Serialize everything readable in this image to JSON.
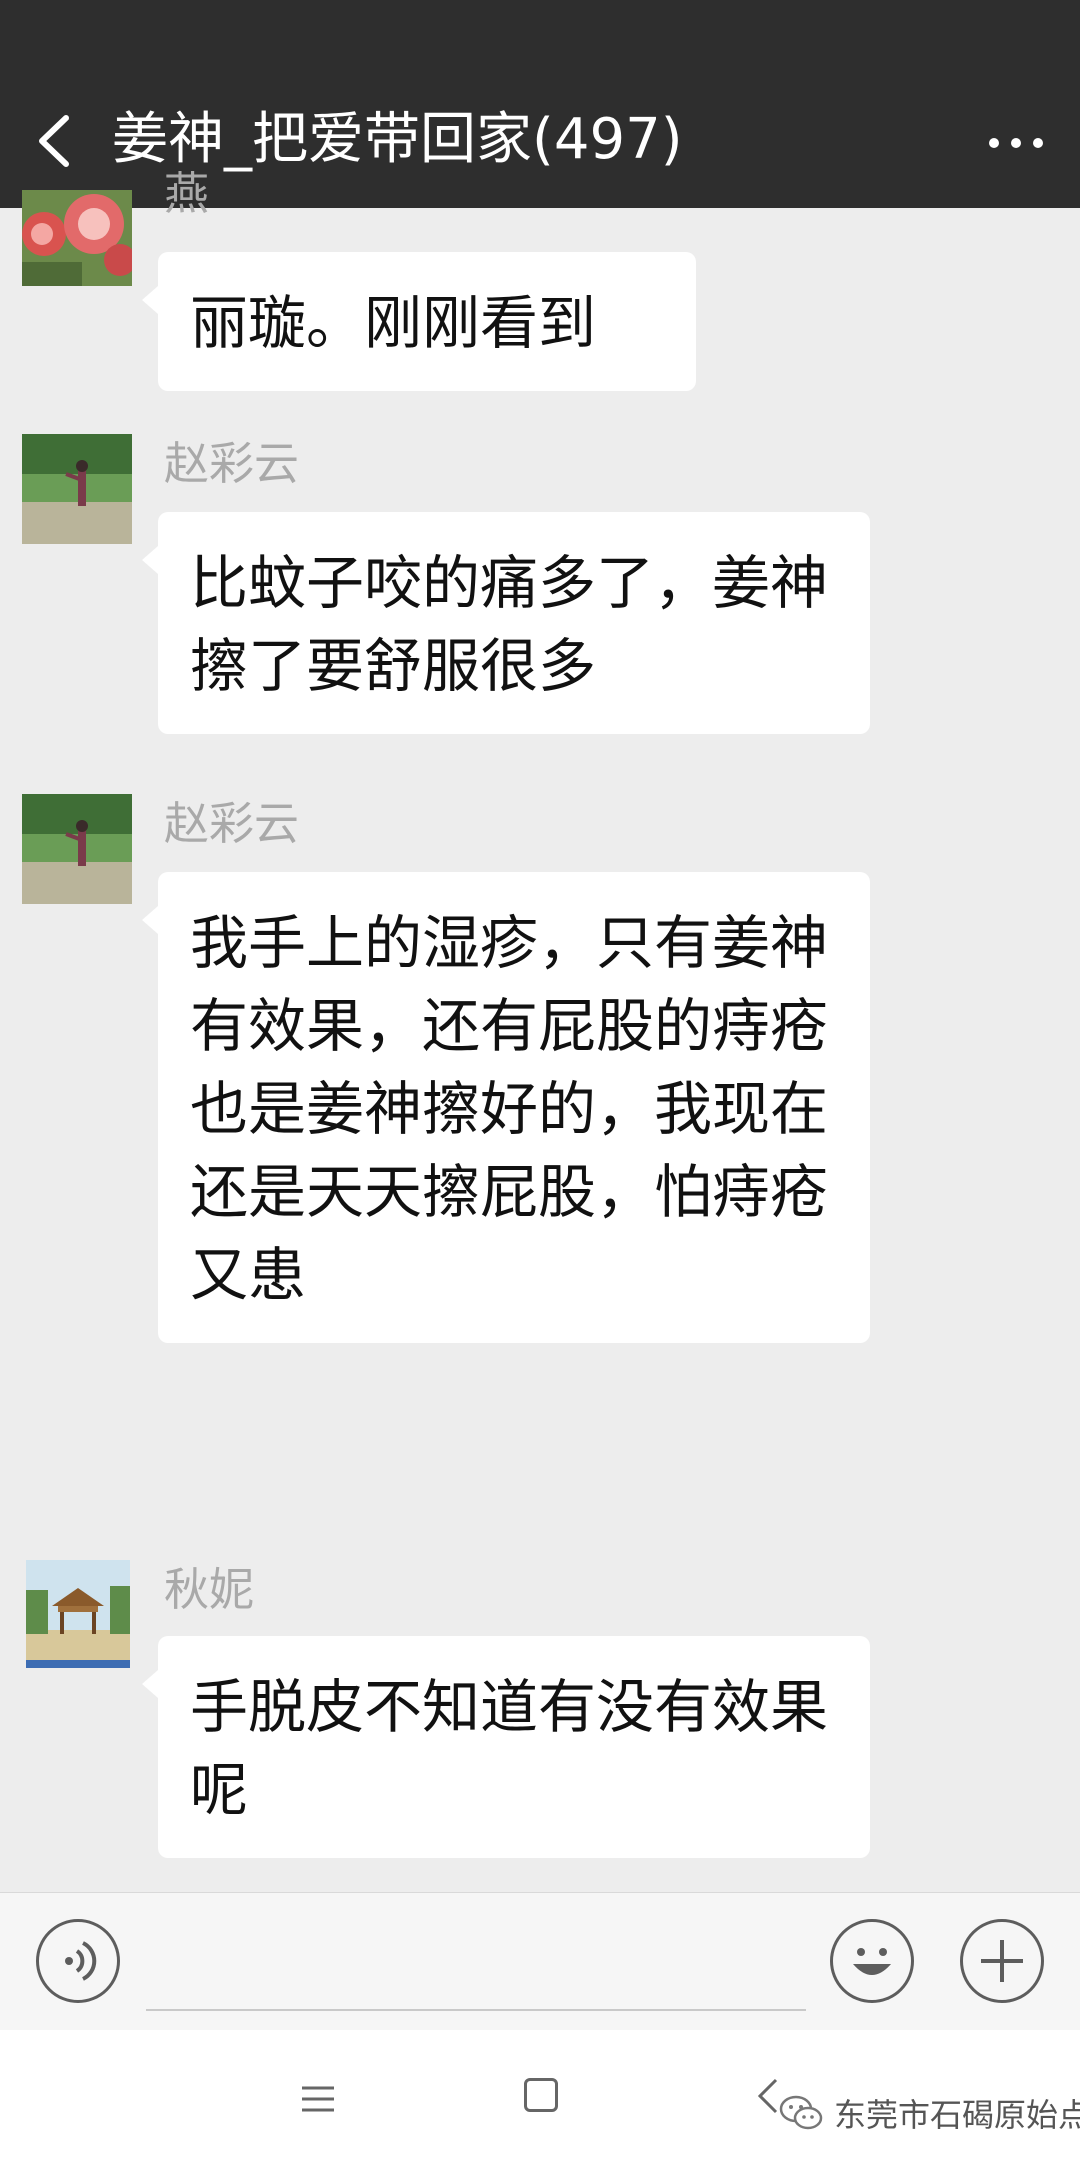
{
  "header": {
    "title": "姜神_把爱带回家(497)",
    "back_icon": "chevron-left-icon",
    "more_icon": "more-horizontal-icon"
  },
  "messages": [
    {
      "sender": "燕",
      "text": "丽璇。刚刚看到",
      "avatar": "peony-flower-avatar"
    },
    {
      "sender": "赵彩云",
      "text": "比蚊子咬的痛多了，姜神擦了要舒服很多",
      "avatar": "park-photo-avatar"
    },
    {
      "sender": "赵彩云",
      "text": "我手上的湿疹，只有姜神有效果，还有屁股的痔疮也是姜神擦好的，我现在还是天天擦屁股，怕痔疮又患",
      "avatar": "park-photo-avatar"
    },
    {
      "sender": "秋妮",
      "text": "手脱皮不知道有没有效果呢",
      "avatar": "pavilion-photo-avatar"
    }
  ],
  "input_bar": {
    "voice_icon": "voice-icon",
    "emoji_icon": "emoji-icon",
    "plus_icon": "plus-icon",
    "text_value": ""
  },
  "nav_bar": {
    "menu_icon": "menu-icon",
    "home_icon": "home-square-icon",
    "back_icon": "back-triangle-icon"
  },
  "watermark": {
    "text": "东莞市石碣原始点",
    "icon": "wechat-logo-icon"
  },
  "colors": {
    "header_bg": "#2e2e2e",
    "chat_bg": "#ededed",
    "bubble_bg": "#ffffff",
    "sender_name": "#a9a9a9"
  }
}
